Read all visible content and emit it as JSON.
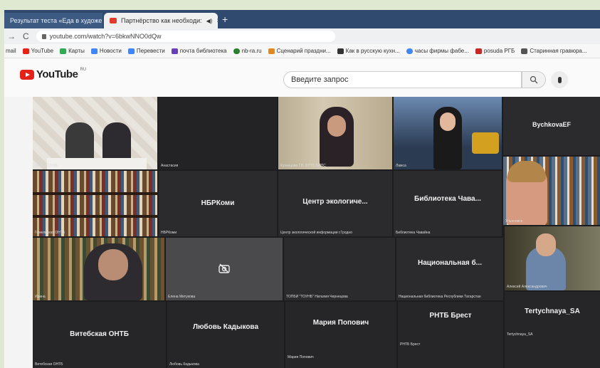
{
  "browser": {
    "tabs": [
      {
        "label": "Результат теста «Еда в художе:",
        "close": "×"
      },
      {
        "label": "Партнёрство как необходи:",
        "close": "×"
      }
    ],
    "new_tab": "+",
    "url": "youtube.com/watch?v=6bkwNNO0dQw",
    "bookmarks": [
      {
        "label": "mail",
        "color": ""
      },
      {
        "label": "YouTube",
        "color": "#e62117"
      },
      {
        "label": "Карты",
        "color": "#34a853"
      },
      {
        "label": "Новости",
        "color": "#4285f4"
      },
      {
        "label": "Перевести",
        "color": "#4285f4"
      },
      {
        "label": "почта библиотека",
        "color": "#6a3fb5"
      },
      {
        "label": "nb-ra.ru",
        "color": "#2e7d32"
      },
      {
        "label": "Сценарий праздни...",
        "color": "#e08a1e"
      },
      {
        "label": "Как в русскую кухн...",
        "color": "#333333"
      },
      {
        "label": "часы фирмы фабе...",
        "color": "#4285f4"
      },
      {
        "label": "posuda РГБ",
        "color": "#c62828"
      },
      {
        "label": "Старинная гравюра...",
        "color": "#555555"
      }
    ]
  },
  "youtube": {
    "logo_text": "YouTube",
    "region": "RU",
    "search_placeholder": "Введите запрос"
  },
  "participants": [
    {
      "name": "",
      "small": "Тверь ТОУНБ"
    },
    {
      "name": "",
      "small": "Анастасия"
    },
    {
      "name": "",
      "small": "Кузнецова Г.В. БПТБ БИПС"
    },
    {
      "name": "",
      "small": "Ламса"
    },
    {
      "name": "BychkovaEF",
      "small": "BychkovaEF"
    },
    {
      "name": "НБРКоми",
      "small": "НБРКоми"
    },
    {
      "name": "Центр экологиче...",
      "small": "Центр экологической информации г.Гродно"
    },
    {
      "name": "Библиотека Чава...",
      "small": "Библиотека Чавайна"
    },
    {
      "name": "",
      "small": "Ульяновск"
    },
    {
      "name": "",
      "small": "Гомельская ОНТБ"
    },
    {
      "name": "",
      "small": "Ирина"
    },
    {
      "name": "",
      "small": "Елена Митукова"
    },
    {
      "name": "",
      "small": "ТОПБИ \"ТОУНБ\" Наталия Чернецова"
    },
    {
      "name": "Национальная б...",
      "small": "Национальная библиотека Республики Татарстан"
    },
    {
      "name": "",
      "small": "Алексей Александрович"
    },
    {
      "name": "Витебская ОНТБ",
      "small": "Витебская ОНТБ"
    },
    {
      "name": "Любовь Кадыкова",
      "small": "Любовь Кадыкова"
    },
    {
      "name": "Мария Попович",
      "small": "Мария Попович"
    },
    {
      "name": "РНТБ Брест",
      "small": "РНТБ Брест"
    },
    {
      "name": "Tertychnaya_SA",
      "small": "Tertychnaya_SA"
    }
  ]
}
